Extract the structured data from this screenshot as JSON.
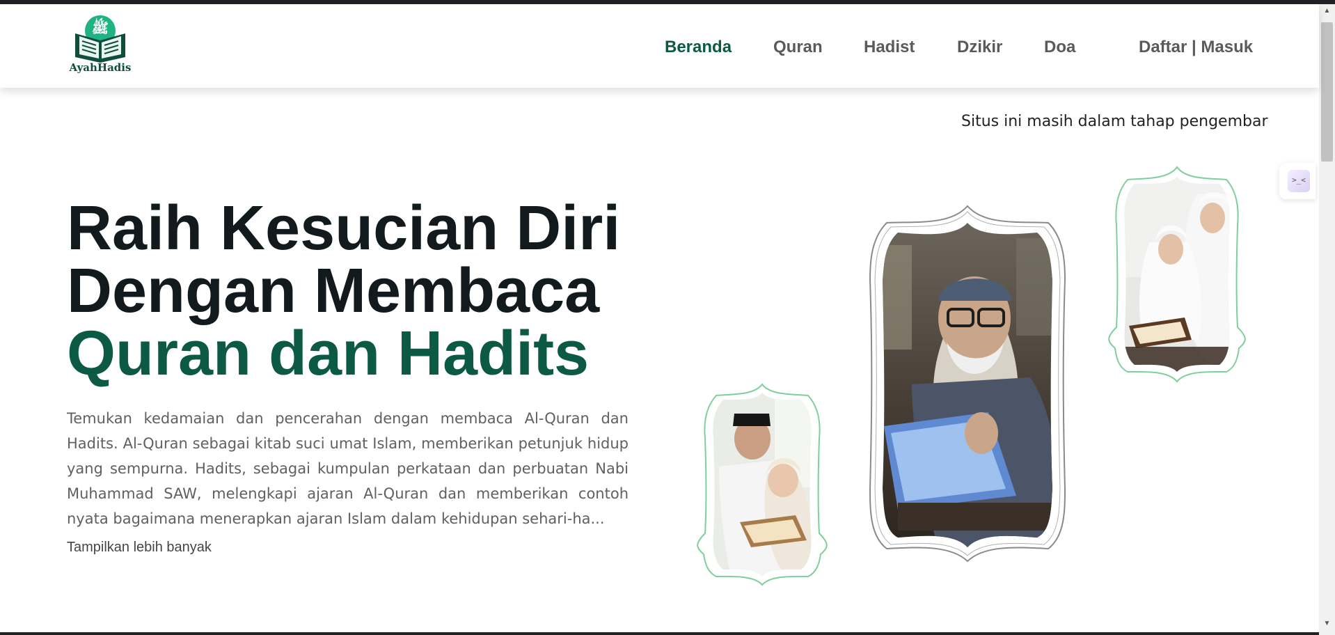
{
  "brand": {
    "name": "AyahHadis"
  },
  "nav": {
    "items": [
      {
        "label": "Beranda",
        "active": true
      },
      {
        "label": "Quran",
        "active": false
      },
      {
        "label": "Hadist",
        "active": false
      },
      {
        "label": "Dzikir",
        "active": false
      },
      {
        "label": "Doa",
        "active": false
      }
    ],
    "auth_label": "Daftar | Masuk"
  },
  "notice": "Situs ini masih dalam tahap pengembar",
  "hero": {
    "title_line1": "Raih Kesucian Diri",
    "title_line2": "Dengan Membaca",
    "title_line3": "Quran dan Hadits",
    "description": "Temukan kedamaian dan pencerahan dengan membaca Al-Quran dan Hadits. Al-Quran sebagai kitab suci umat Islam, memberikan petunjuk hidup yang sempurna. Hadits, sebagai kumpulan perkataan dan perbuatan Nabi Muhammad SAW, melengkapi ajaran Al-Quran dan memberikan contoh nyata bagaimana menerapkan ajaran Islam dalam kehidupan sehari-ha...",
    "more_label": "Tampilkan lebih banyak"
  },
  "widget": {
    "icon": ">_<"
  },
  "colors": {
    "brand_green": "#0d5a44",
    "frame_green": "#7fcf9c",
    "text_dark": "#121a1e",
    "nav_gray": "#5a5a5a"
  },
  "icons": {
    "logo": "quran-book-icon",
    "widget": "chat-widget-icon"
  }
}
